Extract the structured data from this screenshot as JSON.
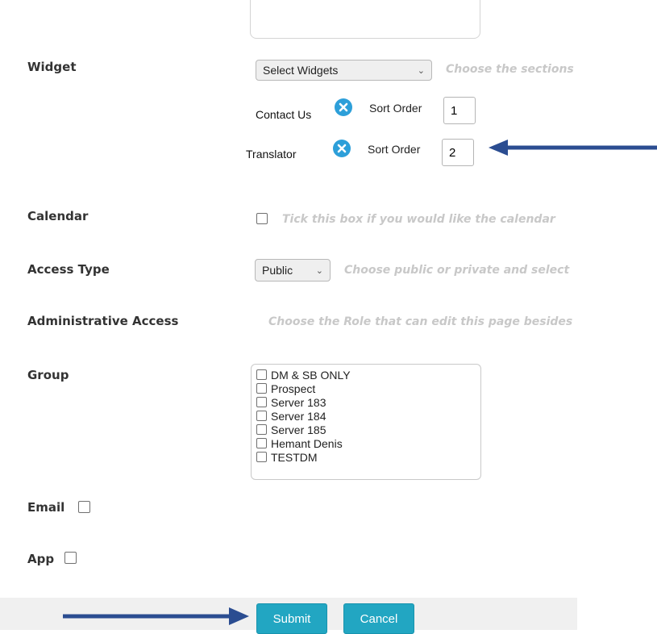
{
  "widget": {
    "label": "Widget",
    "select_value": "Select Widgets",
    "hint": "Choose the sections",
    "items": [
      {
        "name": "Contact Us",
        "sort_label": "Sort Order",
        "sort_value": "1"
      },
      {
        "name": "Translator",
        "sort_label": "Sort Order",
        "sort_value": "2"
      }
    ]
  },
  "calendar": {
    "label": "Calendar",
    "hint": "Tick this box if you would like the calendar"
  },
  "access_type": {
    "label": "Access Type",
    "select_value": "Public",
    "hint": "Choose public or private and select"
  },
  "admin_access": {
    "label": "Administrative Access",
    "hint": "Choose the Role that can edit this page besides"
  },
  "group": {
    "label": "Group",
    "options": [
      "DM & SB ONLY",
      "Prospect",
      "Server 183",
      "Server 184",
      "Server 185",
      "Hemant Denis",
      "TESTDM"
    ]
  },
  "email": {
    "label": "Email"
  },
  "app": {
    "label": "App"
  },
  "buttons": {
    "submit": "Submit",
    "cancel": "Cancel"
  },
  "colors": {
    "arrow": "#2b4d91",
    "button": "#22a6c2",
    "remove_icon": "#2d9fd9"
  }
}
